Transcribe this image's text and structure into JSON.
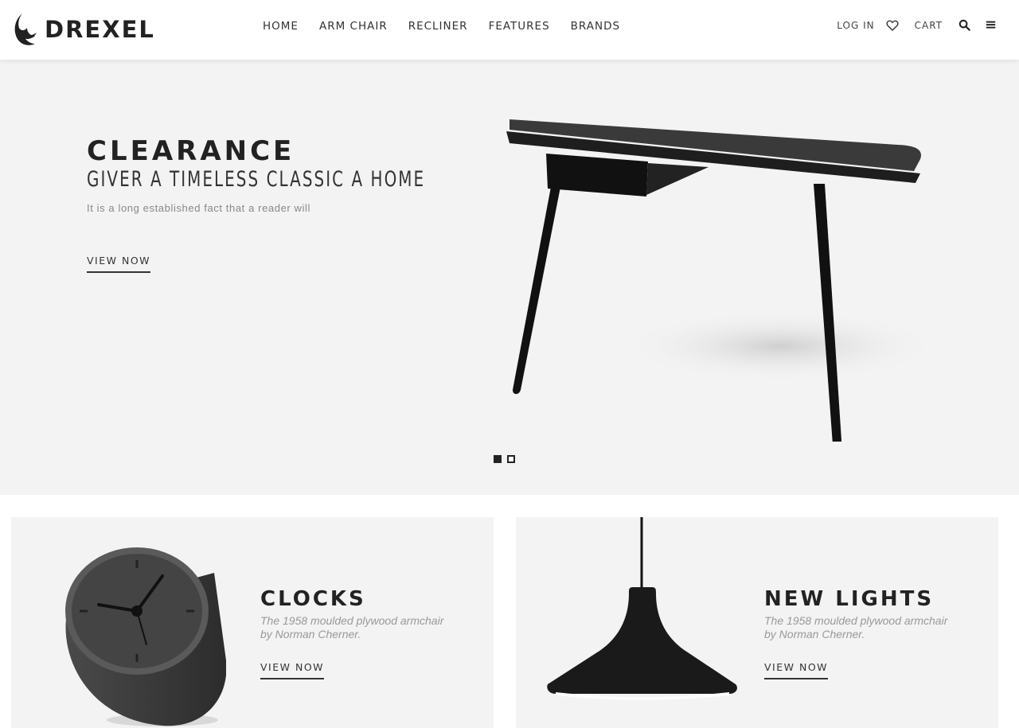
{
  "header": {
    "brand": "DREXEL",
    "nav": [
      "HOME",
      "ARM CHAIR",
      "RECLINER",
      "FEATURES",
      "BRANDS"
    ],
    "login": "LOG IN",
    "cart": "CART",
    "icons": [
      "heart-icon",
      "search-icon",
      "menu-icon"
    ]
  },
  "hero": {
    "title": "CLEARANCE",
    "subtitle": "GIVER A TIMELESS CLASSIC A HOME",
    "text": "It is a long established fact that a reader will",
    "cta": "VIEW NOW",
    "slides": 2,
    "active_slide": 1
  },
  "cards": [
    {
      "title": "CLOCKS",
      "desc_line1": "The 1958 moulded plywood armchair",
      "desc_line2": "by Norman Cherner.",
      "cta": "VIEW NOW"
    },
    {
      "title_light": "NEW",
      "title_bold": "LIGHTS",
      "desc_line1": "The 1958 moulded plywood armchair",
      "desc_line2": "by Norman Cherner.",
      "cta": "VIEW NOW"
    }
  ],
  "colors": {
    "text": "#222222",
    "muted": "#888888",
    "panel": "#f3f3f3"
  }
}
